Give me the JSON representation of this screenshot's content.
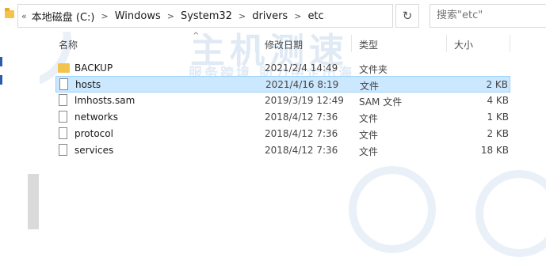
{
  "address": {
    "crumbs": [
      "本地磁盘 (C:)",
      "Windows",
      "System32",
      "drivers",
      "etc"
    ],
    "overflow": "«"
  },
  "search": {
    "placeholder": "搜索\"etc\""
  },
  "columns": {
    "name": "名称",
    "date": "修改日期",
    "type": "类型",
    "size": "大小"
  },
  "files": [
    {
      "name": "BACKUP",
      "date": "2021/2/4 14:49",
      "type": "文件夹",
      "size": "",
      "kind": "folder",
      "selected": false
    },
    {
      "name": "hosts",
      "date": "2021/4/16 8:19",
      "type": "文件",
      "size": "2 KB",
      "kind": "file",
      "selected": true
    },
    {
      "name": "lmhosts.sam",
      "date": "2019/3/19 12:49",
      "type": "SAM 文件",
      "size": "4 KB",
      "kind": "file",
      "selected": false
    },
    {
      "name": "networks",
      "date": "2018/4/12 7:36",
      "type": "文件",
      "size": "1 KB",
      "kind": "file",
      "selected": false
    },
    {
      "name": "protocol",
      "date": "2018/4/12 7:36",
      "type": "文件",
      "size": "2 KB",
      "kind": "file",
      "selected": false
    },
    {
      "name": "services",
      "date": "2018/4/12 7:36",
      "type": "文件",
      "size": "18 KB",
      "kind": "file",
      "selected": false
    }
  ],
  "watermark": {
    "main": "主机测速",
    "sub": "服务跨境 助力中企出海"
  },
  "colors": {
    "selection": "#cce8ff",
    "selection_border": "#99d1ff",
    "folder": "#f4c34e"
  }
}
